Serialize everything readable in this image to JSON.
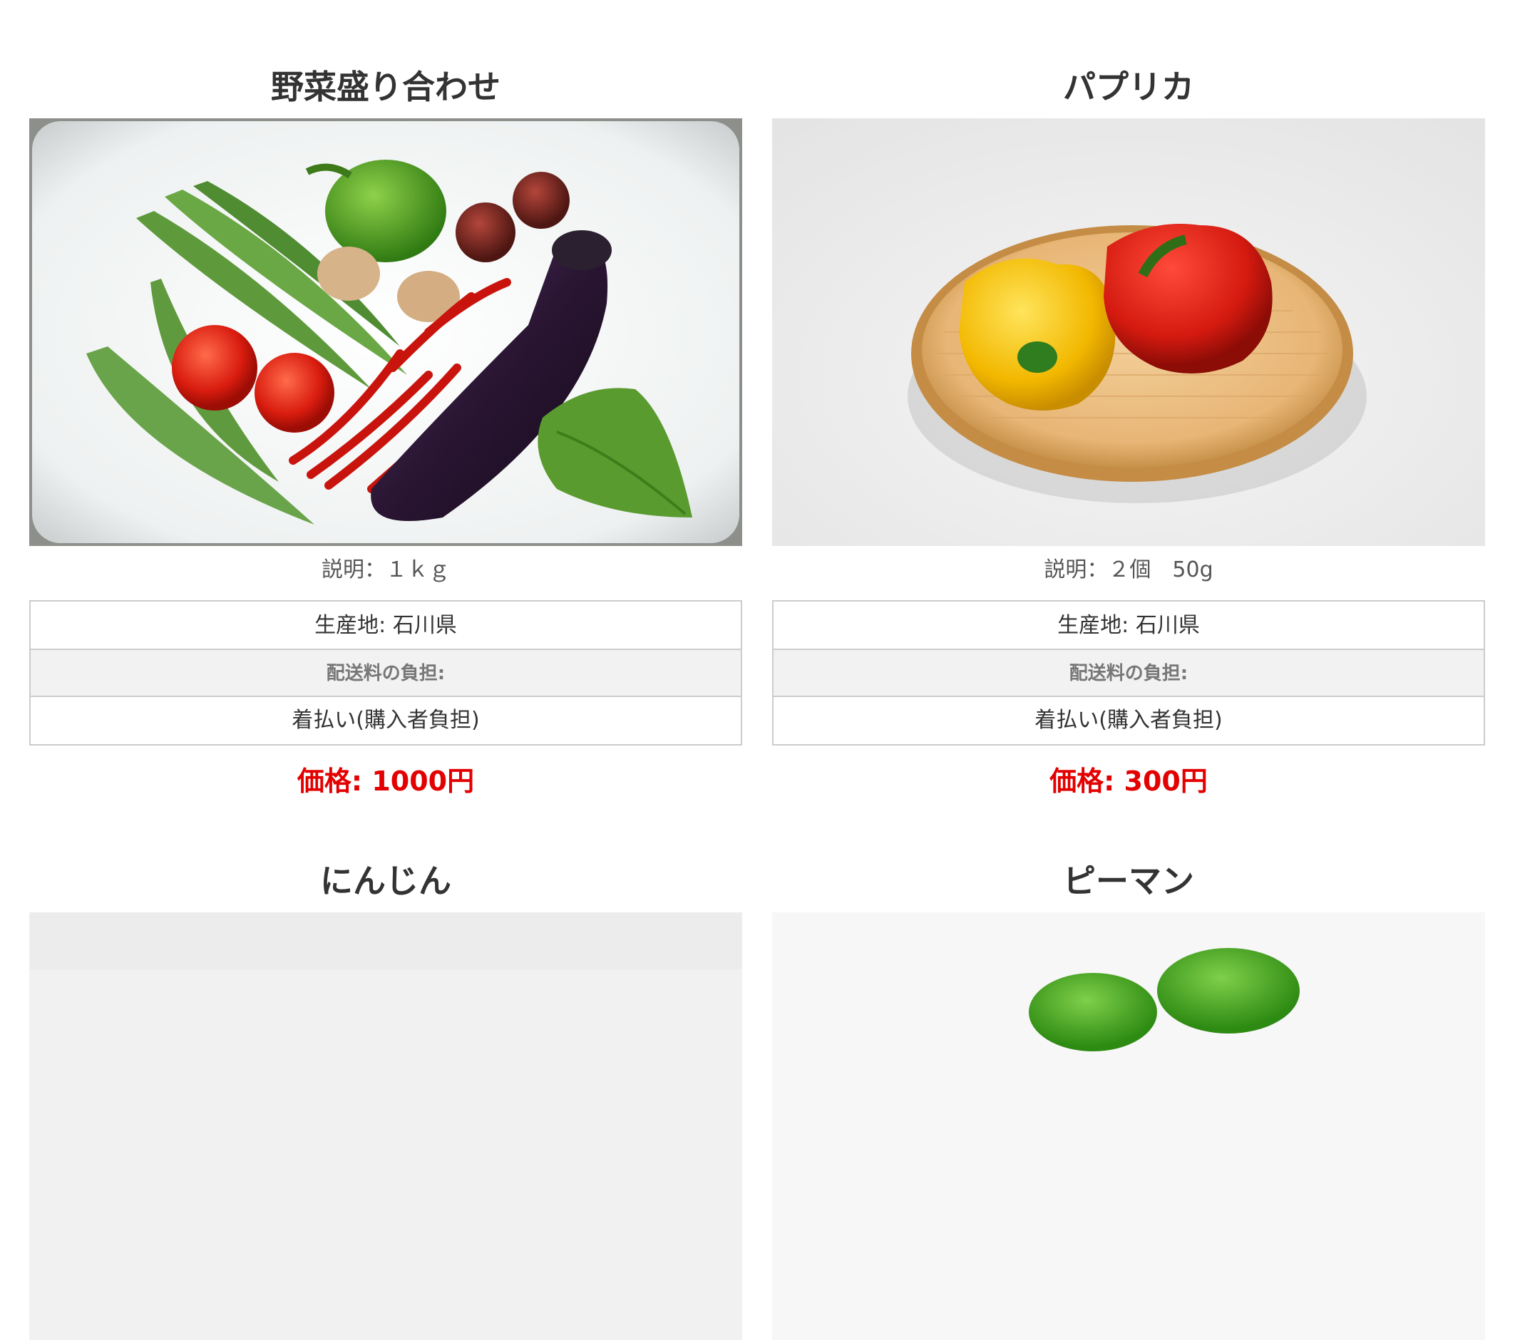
{
  "labels": {
    "description_prefix": "説明：",
    "origin_prefix": "生産地: ",
    "shipping_header": "配送料の負担:",
    "price_prefix": "価格: ",
    "price_suffix": "円"
  },
  "products": [
    {
      "name": "野菜盛り合わせ",
      "description": "説明：１ｋｇ",
      "origin": "生産地: 石川県",
      "shipping_header": "配送料の負担:",
      "shipping": "着払い(購入者負担)",
      "price": "価格: 1000円",
      "image": "vegetable-assortment-photo"
    },
    {
      "name": "パプリカ",
      "description": "説明：２個　50g",
      "origin": "生産地: 石川県",
      "shipping_header": "配送料の負担:",
      "shipping": "着払い(購入者負担)",
      "price": "価格: 300円",
      "image": "paprika-photo"
    },
    {
      "name": "にんじん",
      "image": "carrot-photo"
    },
    {
      "name": "ピーマン",
      "image": "green-pepper-photo"
    }
  ],
  "colors": {
    "price": "#e30000",
    "table_border": "#cccccc",
    "table_header_bg": "#f2f2f2",
    "text": "#333333"
  }
}
